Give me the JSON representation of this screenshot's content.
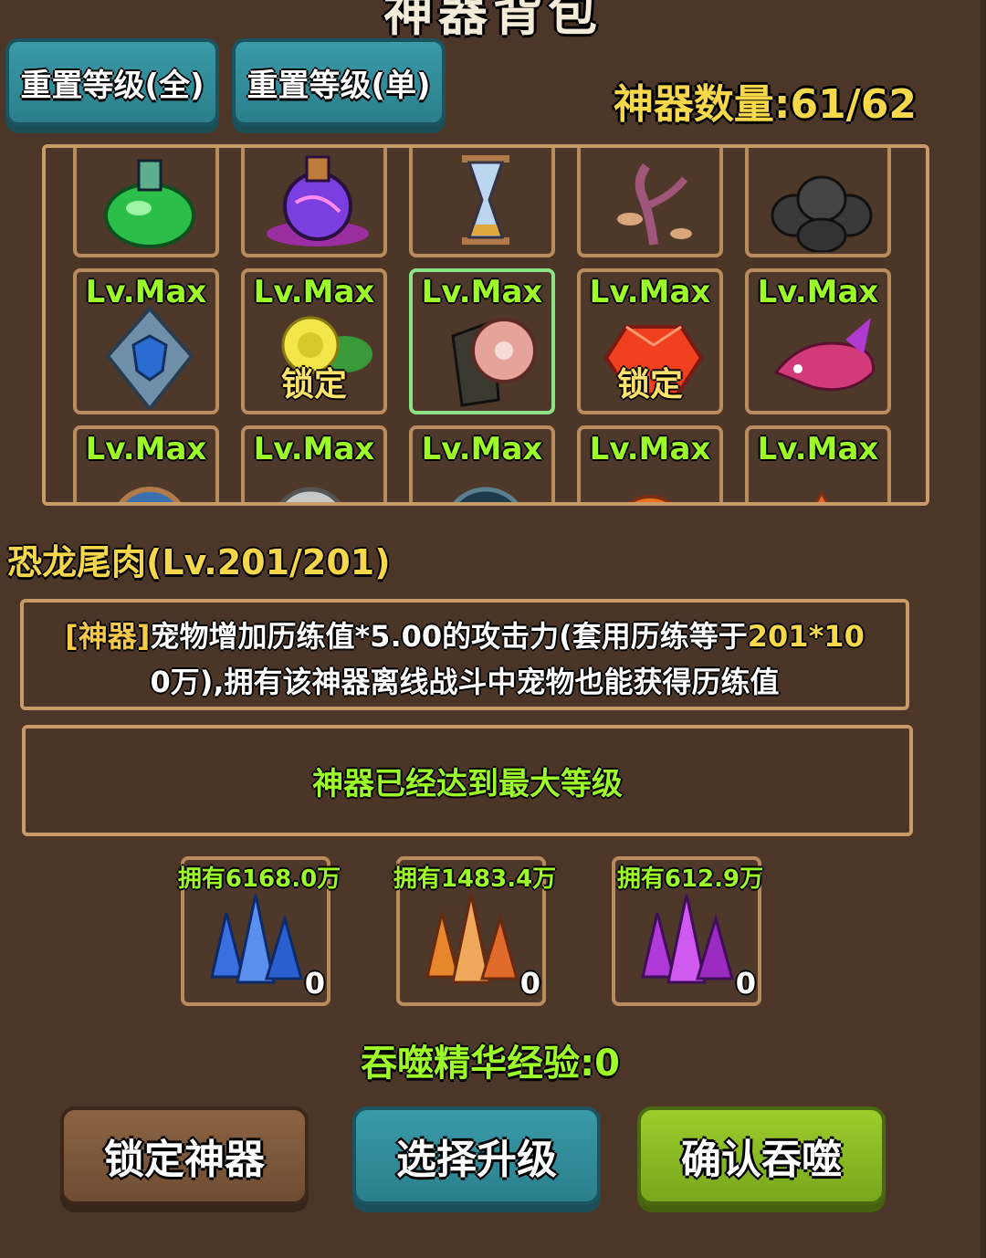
{
  "title": "神器背包",
  "top_buttons": {
    "reset_all": "重置等级(全)",
    "reset_single": "重置等级(单)"
  },
  "artifact_count": "神器数量:61/62",
  "grid": {
    "row1": [
      {
        "icon": "green-potion-icon"
      },
      {
        "icon": "purple-potion-icon"
      },
      {
        "icon": "hourglass-icon"
      },
      {
        "icon": "mushroom-tree-icon"
      },
      {
        "icon": "black-eggs-icon"
      }
    ],
    "row2": [
      {
        "level": "Lv.Max",
        "icon": "shield-crest-icon",
        "lock": ""
      },
      {
        "level": "Lv.Max",
        "icon": "yellow-rose-icon",
        "lock": "锁定"
      },
      {
        "level": "Lv.Max",
        "icon": "dinosaur-tail-meat-icon",
        "lock": ""
      },
      {
        "level": "Lv.Max",
        "icon": "red-gem-icon",
        "lock": "锁定"
      },
      {
        "level": "Lv.Max",
        "icon": "koi-fish-icon",
        "lock": ""
      }
    ],
    "row3": [
      {
        "level": "Lv.Max",
        "icon": "compass-icon"
      },
      {
        "level": "Lv.Max",
        "icon": "pocket-watch-icon"
      },
      {
        "level": "Lv.Max",
        "icon": "radar-icon"
      },
      {
        "level": "Lv.Max",
        "icon": "orange-orb-icon"
      },
      {
        "level": "Lv.Max",
        "icon": "orange-pyramid-icon"
      }
    ]
  },
  "selected_item": {
    "name": "恐龙尾肉(Lv.201/201)",
    "desc_tag": "[神器]",
    "desc_part1": "宠物增加历练值*5.00的攻击力(套用历练等于",
    "desc_num": "201*10",
    "desc_part2": "0万),拥有该神器离线战斗中宠物也能获得历练值"
  },
  "max_level_text": "神器已经达到最大等级",
  "crystals": [
    {
      "own": "拥有6168.0万",
      "qty": "0",
      "icon": "blue-crystal-icon",
      "color": "#3a6fe0"
    },
    {
      "own": "拥有1483.4万",
      "qty": "0",
      "icon": "orange-crystal-icon",
      "color": "#e8862e"
    },
    {
      "own": "拥有612.9万",
      "qty": "0",
      "icon": "purple-crystal-icon",
      "color": "#b03ad8"
    }
  ],
  "exp_text": "吞噬精华经验:0",
  "bottom_buttons": {
    "lock": "锁定神器",
    "select": "选择升级",
    "confirm": "确认吞噬"
  }
}
